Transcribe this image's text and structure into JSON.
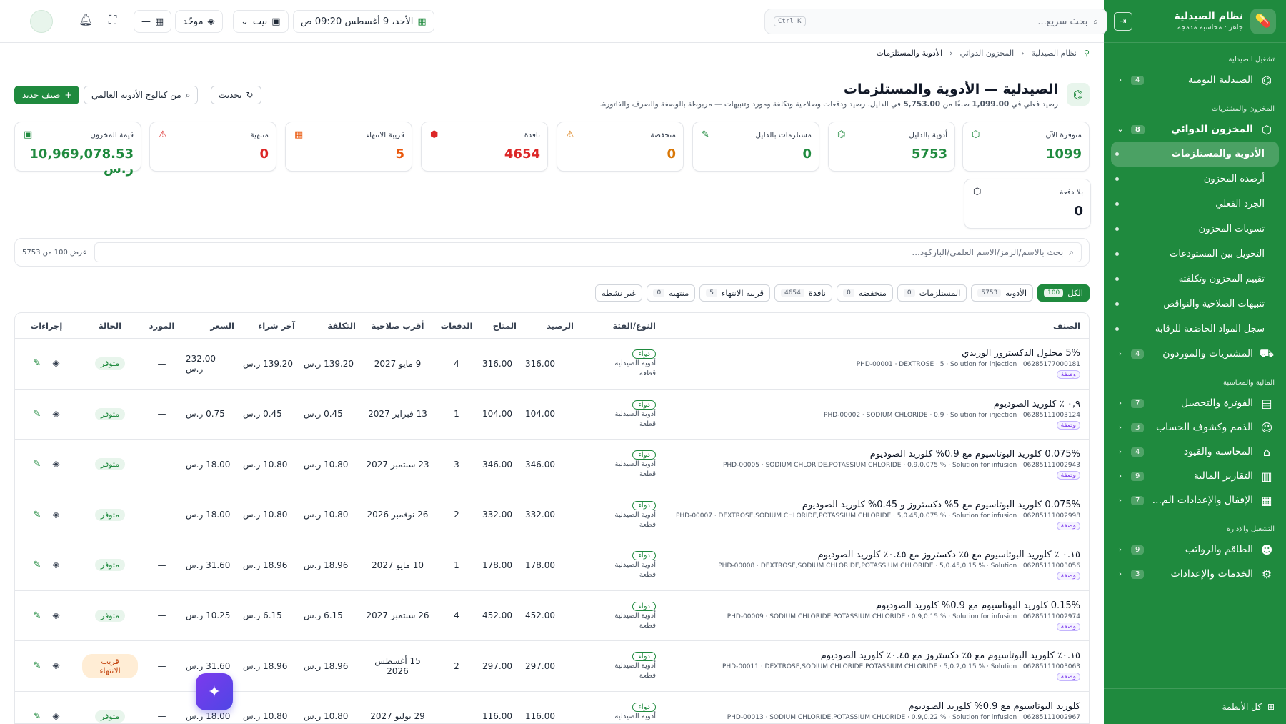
{
  "sidebar": {
    "title": "نظام الصيدلية",
    "subtitle": "جاهز · محاسبة مدمجة",
    "sections": {
      "s1": "تشغيل الصيدلية",
      "s2": "المخزون والمشتريات",
      "s3": "المالية والمحاسبة",
      "s4": "التشغيل والإدارة"
    },
    "daily": {
      "label": "الصيدلية اليومية",
      "count": "4"
    },
    "inventory": {
      "label": "المخزون الدوائي",
      "count": "8"
    },
    "subs": [
      "الأدوية والمستلزمات",
      "أرصدة المخزون",
      "الجرد الفعلي",
      "تسويات المخزون",
      "التحويل بين المستودعات",
      "تقييم المخزون وتكلفته",
      "تنبيهات الصلاحية والنواقص",
      "سجل المواد الخاضعة للرقابة"
    ],
    "purchases": {
      "label": "المشتريات والموردون",
      "count": "4"
    },
    "billing": {
      "label": "الفوترة والتحصيل",
      "count": "7"
    },
    "receivables": {
      "label": "الذمم وكشوف الحساب",
      "count": "3"
    },
    "accounting": {
      "label": "المحاسبة والقيود",
      "count": "4"
    },
    "reports": {
      "label": "التقارير المالية",
      "count": "9"
    },
    "closing": {
      "label": "الإقفال والإعدادات الم...",
      "count": "7"
    },
    "staff": {
      "label": "الطاقم والرواتب",
      "count": "9"
    },
    "services": {
      "label": "الخدمات والإعدادات",
      "count": "3"
    },
    "footer": "كل الأنظمة"
  },
  "topbar": {
    "search_placeholder": "بحث سريع...",
    "shortcut": "Ctrl K",
    "datetime": "الأحد، 9 أغسطس 09:20 ص",
    "location": "بيت",
    "mode": "موحّد",
    "dash": "—"
  },
  "breadcrumb": [
    "نظام الصيدلية",
    "المخزون الدوائي",
    "الأدوية والمستلزمات"
  ],
  "page": {
    "title": "الصيدلية — الأدوية والمستلزمات",
    "subtitle_pre": "رصيد فعلي في",
    "subtitle_n1": "1,099.00",
    "subtitle_mid": "صنفًا من",
    "subtitle_n2": "5,753.00",
    "subtitle_post": "في الدليل. رصيد ودفعات وصلاحية وتكلفة ومورد وتنبيهات — مربوطة بالوصفة والصرف والفاتورة.",
    "btn_refresh": "تحديث",
    "btn_catalog": "من كتالوج الأدوية العالمي",
    "btn_new": "صنف جديد"
  },
  "kpis": [
    {
      "label": "متوفرة الآن",
      "value": "1099",
      "color": "#1f8a3e",
      "icon": "cubes-icon"
    },
    {
      "label": "أدوية بالدليل",
      "value": "5753",
      "color": "#1f8a3e",
      "icon": "pill-icon"
    },
    {
      "label": "مستلزمات بالدليل",
      "value": "0",
      "color": "#1f8a3e",
      "icon": "syringe-icon"
    },
    {
      "label": "منخفضة",
      "value": "0",
      "color": "#d97706",
      "icon": "warning-icon"
    },
    {
      "label": "نافدة",
      "value": "4654",
      "color": "#dc2626",
      "icon": "box-icon"
    },
    {
      "label": "قريبة الانتهاء",
      "value": "5",
      "color": "#ea580c",
      "icon": "calendar-icon"
    },
    {
      "label": "منتهية",
      "value": "0",
      "color": "#dc2626",
      "icon": "alert-icon"
    },
    {
      "label": "قيمة المخزون",
      "value": "10,969,078.53 ر.س",
      "color": "#1f8a3e",
      "icon": "wallet-icon"
    },
    {
      "label": "بلا دفعة",
      "value": "0",
      "color": "#111827",
      "icon": "cubes-icon"
    }
  ],
  "filter": {
    "placeholder": "بحث بالاسم/الرمز/الاسم العلمي/الباركود...",
    "count": "عرض 100 من 5753"
  },
  "chips": [
    {
      "label": "الكل",
      "n": "100"
    },
    {
      "label": "الأدوية",
      "n": "5753"
    },
    {
      "label": "المستلزمات",
      "n": "0"
    },
    {
      "label": "منخفضة",
      "n": "0"
    },
    {
      "label": "نافدة",
      "n": "4654"
    },
    {
      "label": "قريبة الانتهاء",
      "n": "5"
    },
    {
      "label": "منتهية",
      "n": "0"
    },
    {
      "label": "غير نشطة",
      "n": ""
    }
  ],
  "columns": {
    "name": "الصنف",
    "type": "النوع/الفئة",
    "balance": "الرصيد",
    "available": "المتاح",
    "batches": "الدفعات",
    "expiry": "أقرب صلاحية",
    "cost": "التكلفة",
    "last": "آخر شراء",
    "price": "السعر",
    "supplier": "المورد",
    "status": "الحالة",
    "actions": "إجراءات"
  },
  "common": {
    "type_badge": "دواء",
    "type_cat": "أدوية الصيدلية",
    "type_unit": "قطعة",
    "rx": "وصفة",
    "supplier_none": "—"
  },
  "rows": [
    {
      "name": "5% محلول الدكستروز الوريدي",
      "meta": "PHD-00001 · DEXTROSE · 5 · Solution for injection · 06285177000181",
      "balance": "316.00",
      "available": "316.00",
      "batches": "4",
      "expiry": "9 مايو 2027",
      "cost": "139.20 ر.س",
      "last": "139.20 ر.س",
      "price": "232.00 ر.س",
      "status": "متوفر",
      "warn": false
    },
    {
      "name": "٠,٩ ٪ كلوريد الصوديوم",
      "meta": "PHD-00002 · SODIUM CHLORIDE · 0.9 · Solution for injection · 06285111003124",
      "balance": "104.00",
      "available": "104.00",
      "batches": "1",
      "expiry": "13 فبراير 2027",
      "cost": "0.45 ر.س",
      "last": "0.45 ر.س",
      "price": "0.75 ر.س",
      "status": "متوفر",
      "warn": false
    },
    {
      "name": "0.075% كلوريد البوتاسيوم مع 0.9% كلوريد الصوديوم",
      "meta": "PHD-00005 · SODIUM CHLORIDE,POTASSIUM CHLORIDE · 0.9,0.075 % · Solution for infusion · 06285111002943",
      "balance": "346.00",
      "available": "346.00",
      "batches": "3",
      "expiry": "23 سبتمبر 2027",
      "cost": "10.80 ر.س",
      "last": "10.80 ر.س",
      "price": "18.00 ر.س",
      "status": "متوفر",
      "warn": false
    },
    {
      "name": "0.075% كلوريد البوتاسيوم مع 5% دكستروز و 0.45% كلوريد الصوديوم",
      "meta": "PHD-00007 · DEXTROSE,SODIUM CHLORIDE,POTASSIUM CHLORIDE · 5,0.45,0.075 % · Solution for infusion · 06285111002998",
      "balance": "332.00",
      "available": "332.00",
      "batches": "2",
      "expiry": "26 نوفمبر 2026",
      "cost": "10.80 ر.س",
      "last": "10.80 ر.س",
      "price": "18.00 ر.س",
      "status": "متوفر",
      "warn": false
    },
    {
      "name": "٠.١٥ ٪ كلوريد البوتاسيوم مع ٥٪ دكستروز مع ٠.٤٥٪ كلوريد الصوديوم",
      "meta": "PHD-00008 · DEXTROSE,SODIUM CHLORIDE,POTASSIUM CHLORIDE · 5,0.45,0.15 % · Solution · 06285111003056",
      "balance": "178.00",
      "available": "178.00",
      "batches": "1",
      "expiry": "10 مايو 2027",
      "cost": "18.96 ر.س",
      "last": "18.96 ر.س",
      "price": "31.60 ر.س",
      "status": "متوفر",
      "warn": false
    },
    {
      "name": "0.15% كلوريد البوتاسيوم مع 0.9% كلوريد الصوديوم",
      "meta": "PHD-00009 · SODIUM CHLORIDE,POTASSIUM CHLORIDE · 0.9,0.15 % · Solution for infusion · 06285111002974",
      "balance": "452.00",
      "available": "452.00",
      "batches": "4",
      "expiry": "26 سبتمبر 2027",
      "cost": "6.15 ر.س",
      "last": "6.15 ر.س",
      "price": "10.25 ر.س",
      "status": "متوفر",
      "warn": false
    },
    {
      "name": "٠.١٥٪ كلوريد البوتاسيوم مع ٥٪ دكستروز مع ٠.٤٥٪ كلوريد الصوديوم",
      "meta": "PHD-00011 · DEXTROSE,SODIUM CHLORIDE,POTASSIUM CHLORIDE · 5,0.2,0.15 % · Solution · 06285111003063",
      "balance": "297.00",
      "available": "297.00",
      "batches": "2",
      "expiry": "15 أغسطس 2026",
      "cost": "18.96 ر.س",
      "last": "18.96 ر.س",
      "price": "31.60 ر.س",
      "status": "قريب الانتهاء",
      "warn": true
    },
    {
      "name": "كلوريد البوتاسيوم مع 0.9% كلوريد الصوديوم",
      "meta": "PHD-00013 · SODIUM CHLORIDE,POTASSIUM CHLORIDE · 0.9,0.22 % · Solution for infusion · 06285111002967",
      "balance": "116.00",
      "available": "116.00",
      "batches": "",
      "expiry": "29 يوليو 2027",
      "cost": "10.80 ر.س",
      "last": "10.80 ر.س",
      "price": "18.00 ر.س",
      "status": "متوفر",
      "warn": false
    }
  ]
}
